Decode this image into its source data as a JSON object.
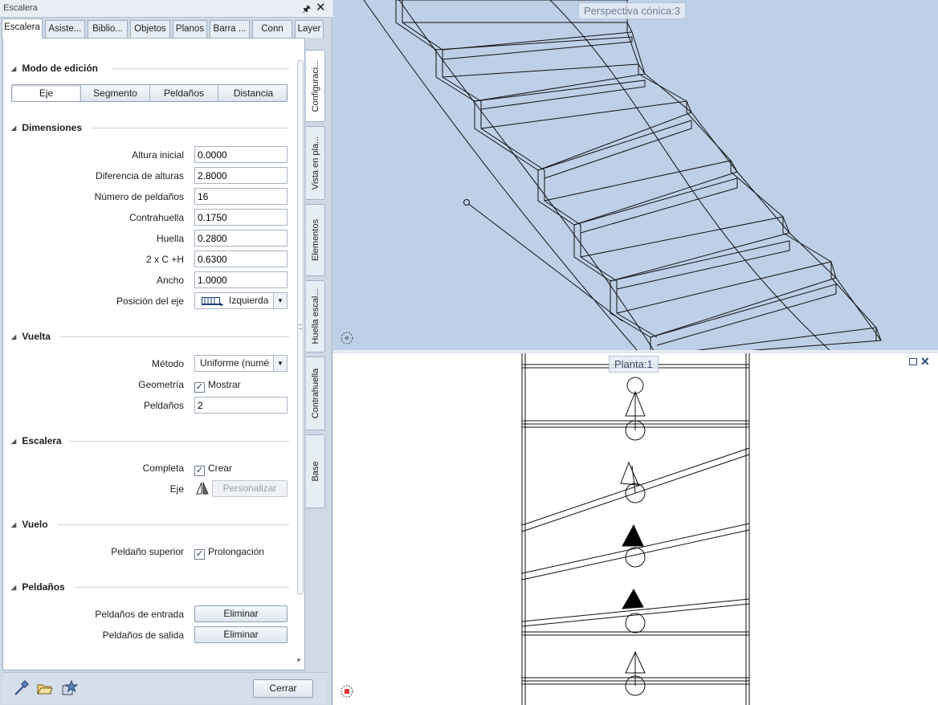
{
  "palette": {
    "title": "Escalera",
    "tabs": [
      "Escalera",
      "Asiste...",
      "Biblio...",
      "Objetos",
      "Planos",
      "Barra ...",
      "Conn",
      "Layer"
    ],
    "side_tabs": [
      "Configuraci...",
      "Vista en pla...",
      "Elementos",
      "Huella escal...",
      "Contrahuella",
      "Base"
    ],
    "close_label": "Cerrar",
    "icons": [
      "pipette-icon",
      "folder-open-icon",
      "favorites-icon"
    ]
  },
  "modo": {
    "title": "Modo de edición",
    "segments": [
      "Eje",
      "Segmento",
      "Peldaños",
      "Distancia"
    ],
    "active": "Eje"
  },
  "dimensiones": {
    "title": "Dimensiones",
    "altura_inicial": {
      "label": "Altura inicial",
      "value": "0.0000"
    },
    "diferencia": {
      "label": "Diferencia de alturas",
      "value": "2.8000"
    },
    "numero": {
      "label": "Número de peldaños",
      "value": "16"
    },
    "contrahuella": {
      "label": "Contrahuella",
      "value": "0.1750"
    },
    "huella": {
      "label": "Huella",
      "value": "0.2800"
    },
    "formula": {
      "label": "2 x C +H",
      "value": "0.6300"
    },
    "ancho": {
      "label": "Ancho",
      "value": "1.0000"
    },
    "posicion": {
      "label": "Posición del eje",
      "value": "Izquierda"
    }
  },
  "vuelta": {
    "title": "Vuelta",
    "metodo": {
      "label": "Método",
      "value": "Uniforme (numé"
    },
    "geometria": {
      "label": "Geometría",
      "check": "Mostrar"
    },
    "peldanos": {
      "label": "Peldaños",
      "value": "2"
    }
  },
  "escalera": {
    "title": "Escalera",
    "completa": {
      "label": "Completa",
      "check": "Crear"
    },
    "eje": {
      "label": "Eje",
      "button": "Personalizar"
    }
  },
  "vuelo": {
    "title": "Vuelo",
    "superior": {
      "label": "Peldaño superior",
      "check": "Prolongación"
    }
  },
  "peldanos": {
    "title": "Peldaños",
    "entrada": {
      "label": "Peldaños de entrada",
      "button": "Eliminar"
    },
    "salida": {
      "label": "Peldaños de salida",
      "button": "Eliminar"
    }
  },
  "viewports": {
    "top_label": "Perspectiva cónica:3",
    "bottom_label": "Planta:1"
  }
}
